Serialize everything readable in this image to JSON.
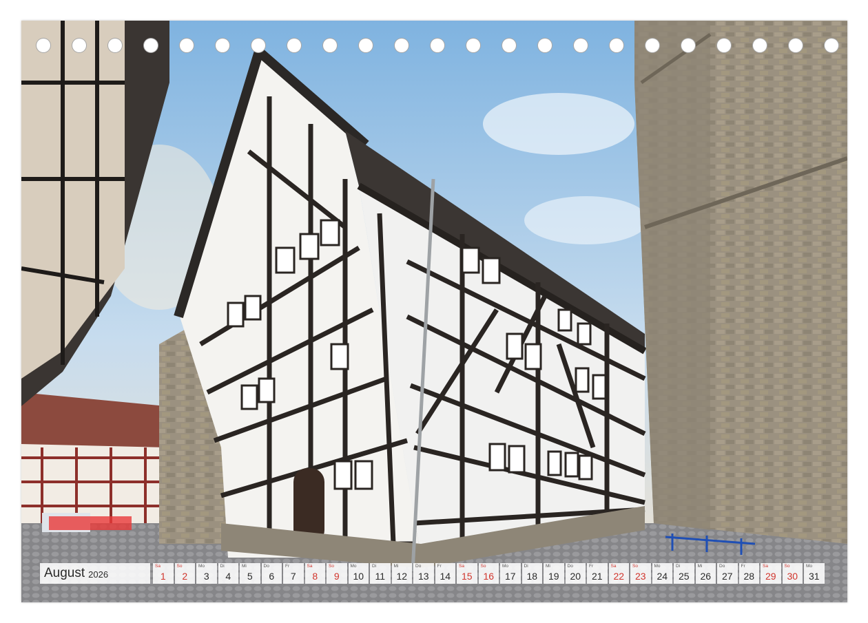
{
  "calendar": {
    "month": "August",
    "year": "2026",
    "days": [
      {
        "num": "1",
        "dow": "Sa",
        "weekend": true
      },
      {
        "num": "2",
        "dow": "So",
        "weekend": true
      },
      {
        "num": "3",
        "dow": "Mo",
        "weekend": false
      },
      {
        "num": "4",
        "dow": "Di",
        "weekend": false
      },
      {
        "num": "5",
        "dow": "Mi",
        "weekend": false
      },
      {
        "num": "6",
        "dow": "Do",
        "weekend": false
      },
      {
        "num": "7",
        "dow": "Fr",
        "weekend": false
      },
      {
        "num": "8",
        "dow": "Sa",
        "weekend": true
      },
      {
        "num": "9",
        "dow": "So",
        "weekend": true
      },
      {
        "num": "10",
        "dow": "Mo",
        "weekend": false
      },
      {
        "num": "11",
        "dow": "Di",
        "weekend": false
      },
      {
        "num": "12",
        "dow": "Mi",
        "weekend": false
      },
      {
        "num": "13",
        "dow": "Do",
        "weekend": false
      },
      {
        "num": "14",
        "dow": "Fr",
        "weekend": false
      },
      {
        "num": "15",
        "dow": "Sa",
        "weekend": true
      },
      {
        "num": "16",
        "dow": "So",
        "weekend": true
      },
      {
        "num": "17",
        "dow": "Mo",
        "weekend": false
      },
      {
        "num": "18",
        "dow": "Di",
        "weekend": false
      },
      {
        "num": "19",
        "dow": "Mi",
        "weekend": false
      },
      {
        "num": "20",
        "dow": "Do",
        "weekend": false
      },
      {
        "num": "21",
        "dow": "Fr",
        "weekend": false
      },
      {
        "num": "22",
        "dow": "Sa",
        "weekend": true
      },
      {
        "num": "23",
        "dow": "So",
        "weekend": true
      },
      {
        "num": "24",
        "dow": "Mo",
        "weekend": false
      },
      {
        "num": "25",
        "dow": "Di",
        "weekend": false
      },
      {
        "num": "26",
        "dow": "Mi",
        "weekend": false
      },
      {
        "num": "27",
        "dow": "Do",
        "weekend": false
      },
      {
        "num": "28",
        "dow": "Fr",
        "weekend": false
      },
      {
        "num": "29",
        "dow": "Sa",
        "weekend": true
      },
      {
        "num": "30",
        "dow": "So",
        "weekend": true
      },
      {
        "num": "31",
        "dow": "Mo",
        "weekend": false
      }
    ]
  },
  "colors": {
    "weekend": "#d0342c",
    "text": "#2a2a2a"
  },
  "binding": {
    "hole_count": 23
  }
}
